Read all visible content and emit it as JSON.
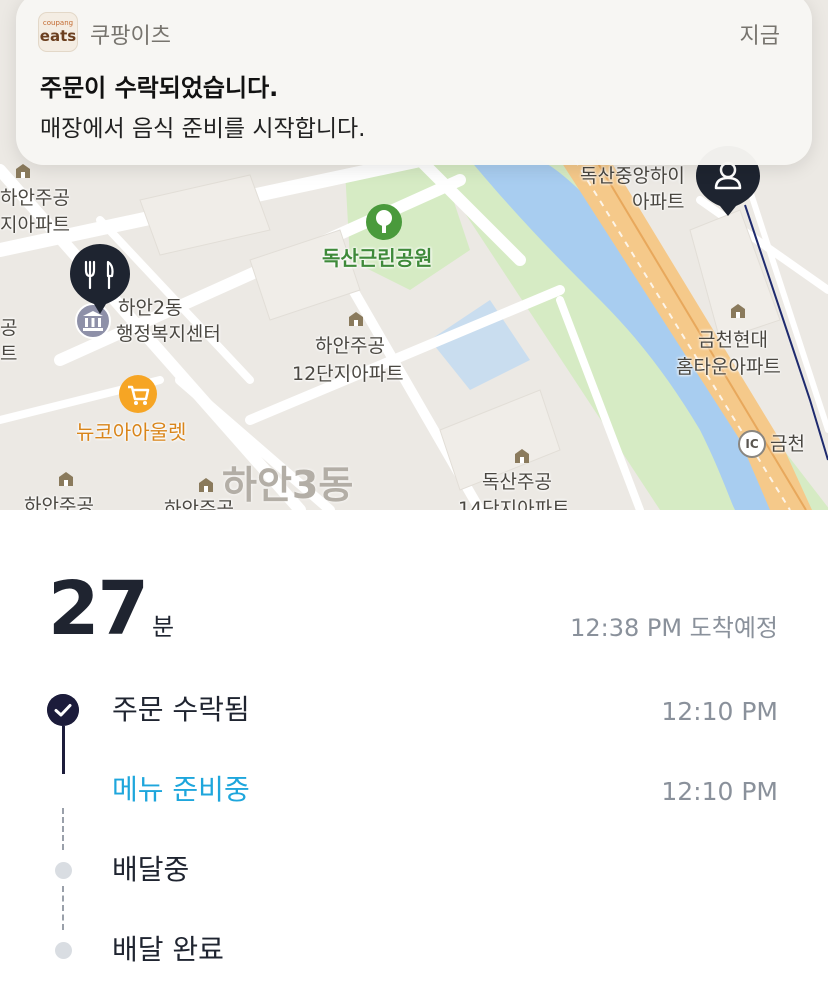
{
  "notification": {
    "app_icon_small": "coupang",
    "app_icon_big": "eats",
    "app_name": "쿠팡이츠",
    "time": "지금",
    "title": "주문이 수락되었습니다.",
    "body": "매장에서 음식 준비를 시작합니다."
  },
  "map": {
    "labels": {
      "hanan_gong": "하안주공",
      "jiapat": "지아파트",
      "doksan_jungang_1": "독산중앙하이",
      "doksan_jungang_2": "아파트",
      "park": "독산근린공원",
      "hanan2dong_1": "하안2동",
      "hanan2dong_2": "행정복지센터",
      "left_cut_1": "공",
      "left_cut_2": "트",
      "hanan12_1": "하안주공",
      "hanan12_2": "12단지아파트",
      "geumcheon_1": "금천현대",
      "geumcheon_2": "홈타운아파트",
      "newcore": "뉴코아아울렛",
      "ic_badge": "IC",
      "ic_name": "금천",
      "hanan3dong": "하안3동",
      "doksan14_1": "독산주공",
      "doksan14_2": "14단지아파트",
      "bottom_left_1": "하안주공",
      "bottom_left_2": "하안주공"
    },
    "icons": [
      "fork-knife-icon",
      "person-icon",
      "building-icon",
      "park-icon",
      "shopping-cart-icon",
      "government-icon"
    ]
  },
  "eta": {
    "minutes": "27",
    "unit": "분",
    "arrival": "12:38 PM 도착예정"
  },
  "steps": [
    {
      "label": "주문 수락됨",
      "time": "12:10 PM",
      "status": "done"
    },
    {
      "label": "메뉴 준비중",
      "time": "12:10 PM",
      "status": "active"
    },
    {
      "label": "배달중",
      "time": "",
      "status": "pending"
    },
    {
      "label": "배달 완료",
      "time": "",
      "status": "pending"
    }
  ],
  "colors": {
    "accent": "#1ea6dc",
    "dark_navy": "#1c1c3b",
    "muted": "#8a919b",
    "pending_dot": "#d9dde2",
    "park_green": "#3f8a3a",
    "river": "#a8cdf0",
    "highway": "#f5c98a"
  }
}
